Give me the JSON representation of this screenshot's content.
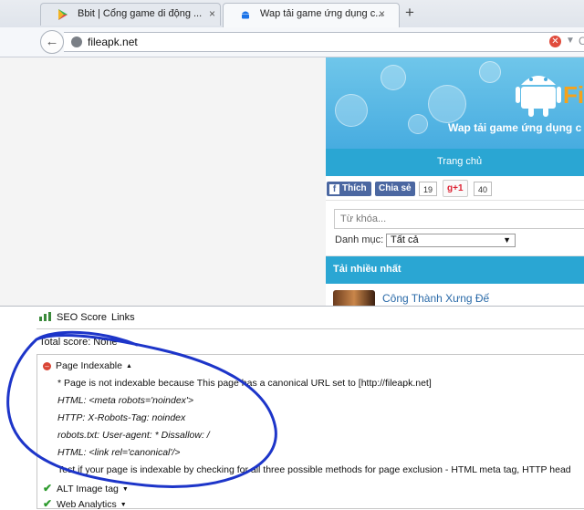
{
  "browser": {
    "tabs": [
      {
        "title": "Bbit | Cổng game di động ...",
        "close": "×",
        "favicon": "play-store-icon",
        "active": false
      },
      {
        "title": "Wap tải game ứng dụng c...",
        "close": "×",
        "favicon": "android-icon",
        "active": true
      }
    ],
    "new_tab": "+",
    "back": "←",
    "url": "fileapk.net",
    "stop": "✕",
    "dropdown": "▼",
    "reload": "C"
  },
  "site": {
    "logo_letter": "Fi",
    "slogan": "Wap tải game ứng dụng c",
    "nav_home": "Trang chủ",
    "fb_like": "Thích",
    "fb_like_glyph": "f",
    "fb_share": "Chia sẻ",
    "share_count": "19",
    "gplus": "g+1",
    "gplus_count": "40",
    "search_placeholder": "Từ khóa...",
    "category_label": "Danh mục:",
    "category_value": "Tất cả",
    "category_arrow": "▼",
    "top_downloads": "Tải nhiều nhất",
    "first_item_title": "Công Thành Xưng Đế",
    "colors": {
      "banner": "#47ace0",
      "nav": "#2aa6d3",
      "logo": "#f6a21a"
    }
  },
  "seo_panel": {
    "tabs": [
      "SEO Score",
      "Links"
    ],
    "total_score": "Total score: None",
    "sections": [
      {
        "title": "Page Indexable",
        "status": "fail",
        "arrow": "▲"
      },
      {
        "title": "ALT Image tag",
        "status": "pass",
        "arrow": "▼"
      },
      {
        "title": "Web Analytics",
        "status": "pass",
        "arrow": "▼"
      }
    ],
    "details": [
      "* Page is not indexable because This page has a canonical URL set to [http://fileapk.net]",
      "HTML: <meta robots='noindex'>",
      "HTTP: X-Robots-Tag: noindex",
      "robots.txt: User-agent: * Dissallow: /",
      "HTML: <link rel='canonical'/>",
      "Test if your page is indexable by checking for all three possible methods for page exclusion - HTML meta tag, HTTP head"
    ],
    "status_glyphs": {
      "fail": "–",
      "pass": "✔"
    }
  }
}
